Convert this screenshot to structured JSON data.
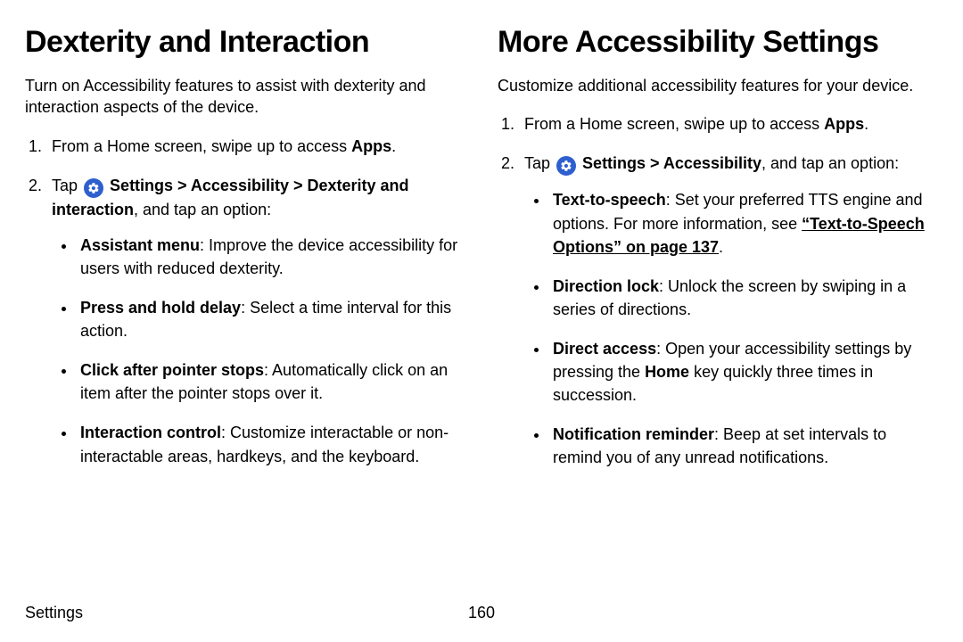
{
  "left": {
    "heading": "Dexterity and Interaction",
    "intro": "Turn on Accessibility features to assist with dexterity and interaction aspects of the device.",
    "step1_pre": "From a Home screen, swipe up to access ",
    "step1_bold": "Apps",
    "step1_post": ".",
    "step2_pre": "Tap ",
    "step2_boldpath": "Settings > Accessibility > Dexterity and interaction",
    "step2_post": ", and tap an option:",
    "b1_bold": "Assistant menu",
    "b1_rest": ": Improve the device accessibility for users with reduced dexterity.",
    "b2_bold": "Press and hold delay",
    "b2_rest": ": Select a time interval for this action.",
    "b3_bold": "Click after pointer stops",
    "b3_rest": ": Automatically click on an item after the pointer stops over it.",
    "b4_bold": "Interaction control",
    "b4_rest": ": Customize interactable or non-interactable areas, hardkeys, and the keyboard."
  },
  "right": {
    "heading": "More Accessibility Settings",
    "intro": "Customize additional accessibility features for your device.",
    "step1_pre": "From a Home screen, swipe up to access ",
    "step1_bold": "Apps",
    "step1_post": ".",
    "step2_pre": "Tap ",
    "step2_boldpath": "Settings > Accessibility",
    "step2_post": ", and tap an option:",
    "b1_bold": "Text-to-speech",
    "b1_mid": ": Set your preferred TTS engine and options. For more information, see ",
    "b1_link": "“Text-to-Speech Options” on page 137",
    "b1_end": ".",
    "b2_bold": "Direction lock",
    "b2_rest": ": Unlock the screen by swiping in a series of directions.",
    "b3_bold": "Direct access",
    "b3_pre": ": Open your accessibility settings by pressing the ",
    "b3_homebold": "Home",
    "b3_post": " key quickly three times in succession.",
    "b4_bold": "Notification reminder",
    "b4_rest": ": Beep at set intervals to remind you of any unread notifications."
  },
  "footer": {
    "section": "Settings",
    "page": "160"
  }
}
